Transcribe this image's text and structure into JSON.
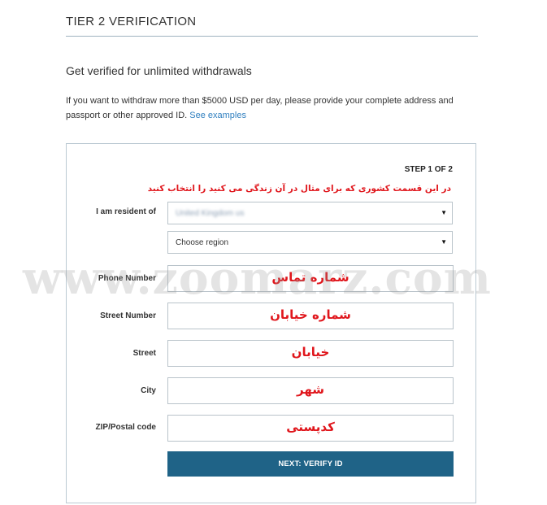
{
  "header": {
    "title": "TIER 2 VERIFICATION",
    "subtitle": "Get verified for unlimited withdrawals",
    "description": "If you want to withdraw more than $5000 USD per day, please provide your complete address and passport or other approved ID.",
    "link_text": "See examples"
  },
  "form": {
    "step": "STEP 1 OF 2",
    "note": "در این قسمت کشوری که برای مثال در آن زندگی می کنید را انتخاب کنید",
    "resident_label": "I am resident of",
    "resident_value": "United Kingdom us",
    "region_value": "Choose region",
    "phone_label": "Phone Number",
    "phone_value": "شماره تماس",
    "street_number_label": "Street Number",
    "street_number_value": "شماره خیابان",
    "street_label": "Street",
    "street_value": "خیابان",
    "city_label": "City",
    "city_value": "شهر",
    "zip_label": "ZIP/Postal code",
    "zip_value": "کدپستی",
    "submit_label": "NEXT: VERIFY ID"
  },
  "watermark": "www.zoomarz.com",
  "colors": {
    "primary_button": "#1f6387",
    "link": "#2f7fbf",
    "annotation_red": "#e0161c",
    "border": "#b9c3ca"
  }
}
